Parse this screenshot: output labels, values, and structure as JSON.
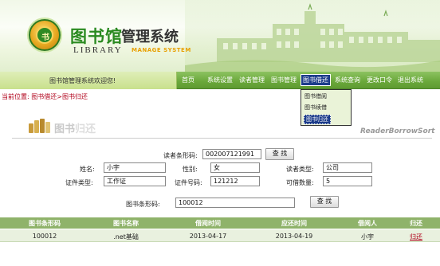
{
  "header": {
    "logo_main": "图书馆",
    "logo_sub": "管理系统",
    "logo_en": "LIBRARY",
    "logo_en2": "MANAGE SYSTEM",
    "emblem_text": "书"
  },
  "nav": {
    "welcome": "图书馆管理系统欢迎您!",
    "items": [
      "首页",
      "系统设置",
      "读者管理",
      "图书管理",
      "图书借还",
      "系统查询",
      "更改口令",
      "退出系统"
    ],
    "active": "图书借还"
  },
  "dropdown": {
    "items": [
      "图书借阅",
      "图书续借",
      "图书归还"
    ],
    "selected": "图书归还"
  },
  "breadcrumb": "当前位置: 图书借还>图书归还",
  "section": {
    "title_a": "图书",
    "title_b": "归还",
    "title_en": "ReaderBorrowSort"
  },
  "reader_search": {
    "label": "读者条形码:",
    "value": "002007121991",
    "button": "查 找"
  },
  "reader_info": {
    "name_label": "姓名:",
    "name": "小宇",
    "gender_label": "性别:",
    "gender": "女",
    "type_label": "读者类型:",
    "type": "公司",
    "cert_type_label": "证件类型:",
    "cert_type": "工作证",
    "cert_no_label": "证件号码:",
    "cert_no": "121212",
    "quota_label": "可借数量:",
    "quota": "5"
  },
  "book_search": {
    "label": "图书条形码:",
    "value": "100012",
    "button": "查 找"
  },
  "table": {
    "headers": [
      "图书条形码",
      "图书名称",
      "借阅时间",
      "应还时间",
      "借阅人",
      "归还"
    ],
    "rows": [
      [
        "100012",
        ".net基础",
        "2013-04-17",
        "2013-04-19",
        "小宇",
        "归还"
      ]
    ]
  },
  "colors": {
    "nav_green": "#6aa83a",
    "active_blue": "#1c3c8a",
    "breadcrumb_red": "#b0001a",
    "table_head": "#8fb36a"
  }
}
